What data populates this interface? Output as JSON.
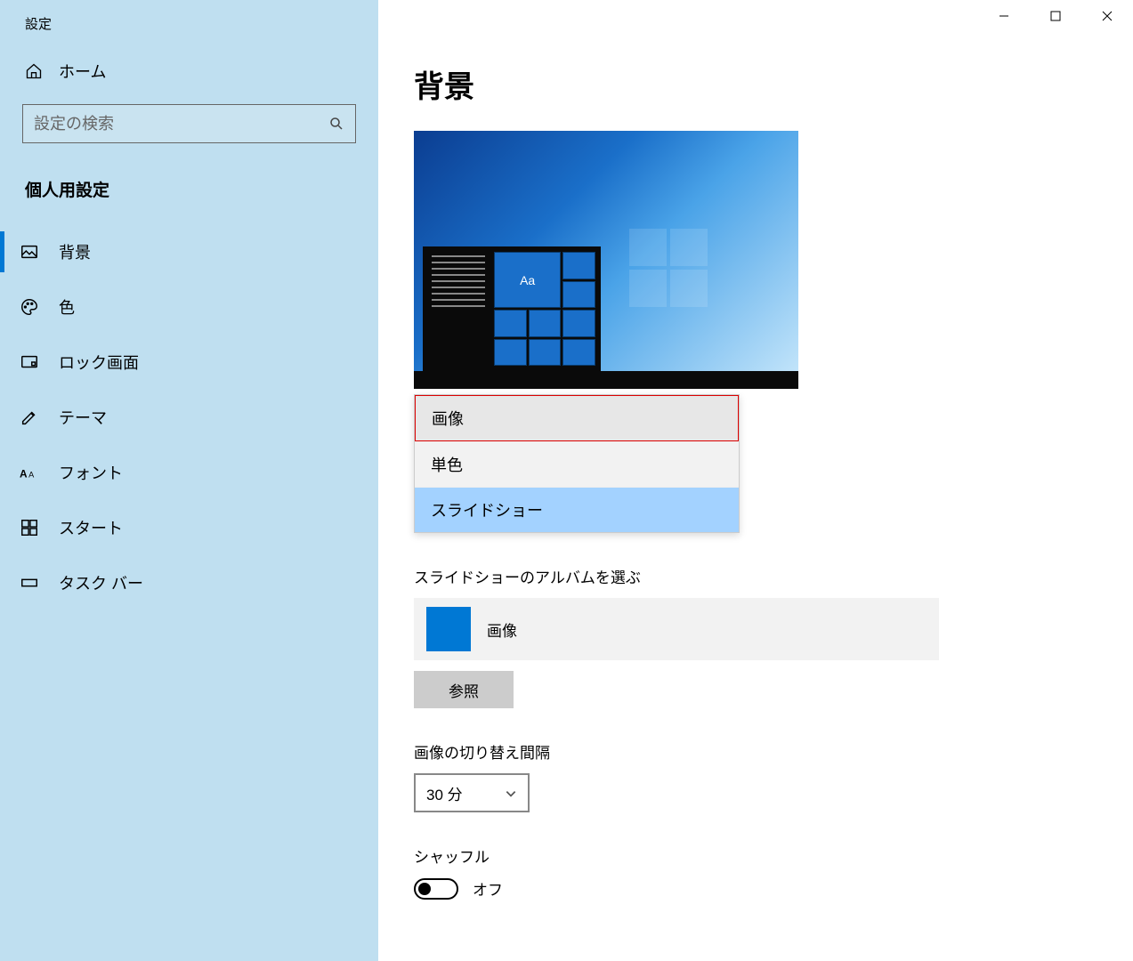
{
  "window": {
    "title": "設定"
  },
  "sidebar": {
    "home": "ホーム",
    "search_placeholder": "設定の検索",
    "category": "個人用設定",
    "items": [
      {
        "label": "背景",
        "icon": "image-icon"
      },
      {
        "label": "色",
        "icon": "palette-icon"
      },
      {
        "label": "ロック画面",
        "icon": "lock-screen-icon"
      },
      {
        "label": "テーマ",
        "icon": "theme-icon"
      },
      {
        "label": "フォント",
        "icon": "font-icon"
      },
      {
        "label": "スタート",
        "icon": "start-icon"
      },
      {
        "label": "タスク バー",
        "icon": "taskbar-icon"
      }
    ]
  },
  "main": {
    "title": "背景",
    "preview_sample_text": "Aa",
    "background_dropdown": {
      "options": [
        "画像",
        "単色",
        "スライドショー"
      ],
      "highlighted_index": 0,
      "selected_index": 2
    },
    "album": {
      "label": "スライドショーのアルバムを選ぶ",
      "name": "画像",
      "browse": "参照"
    },
    "interval": {
      "label": "画像の切り替え間隔",
      "value": "30 分"
    },
    "shuffle": {
      "label": "シャッフル",
      "state": "オフ",
      "on": false
    }
  }
}
